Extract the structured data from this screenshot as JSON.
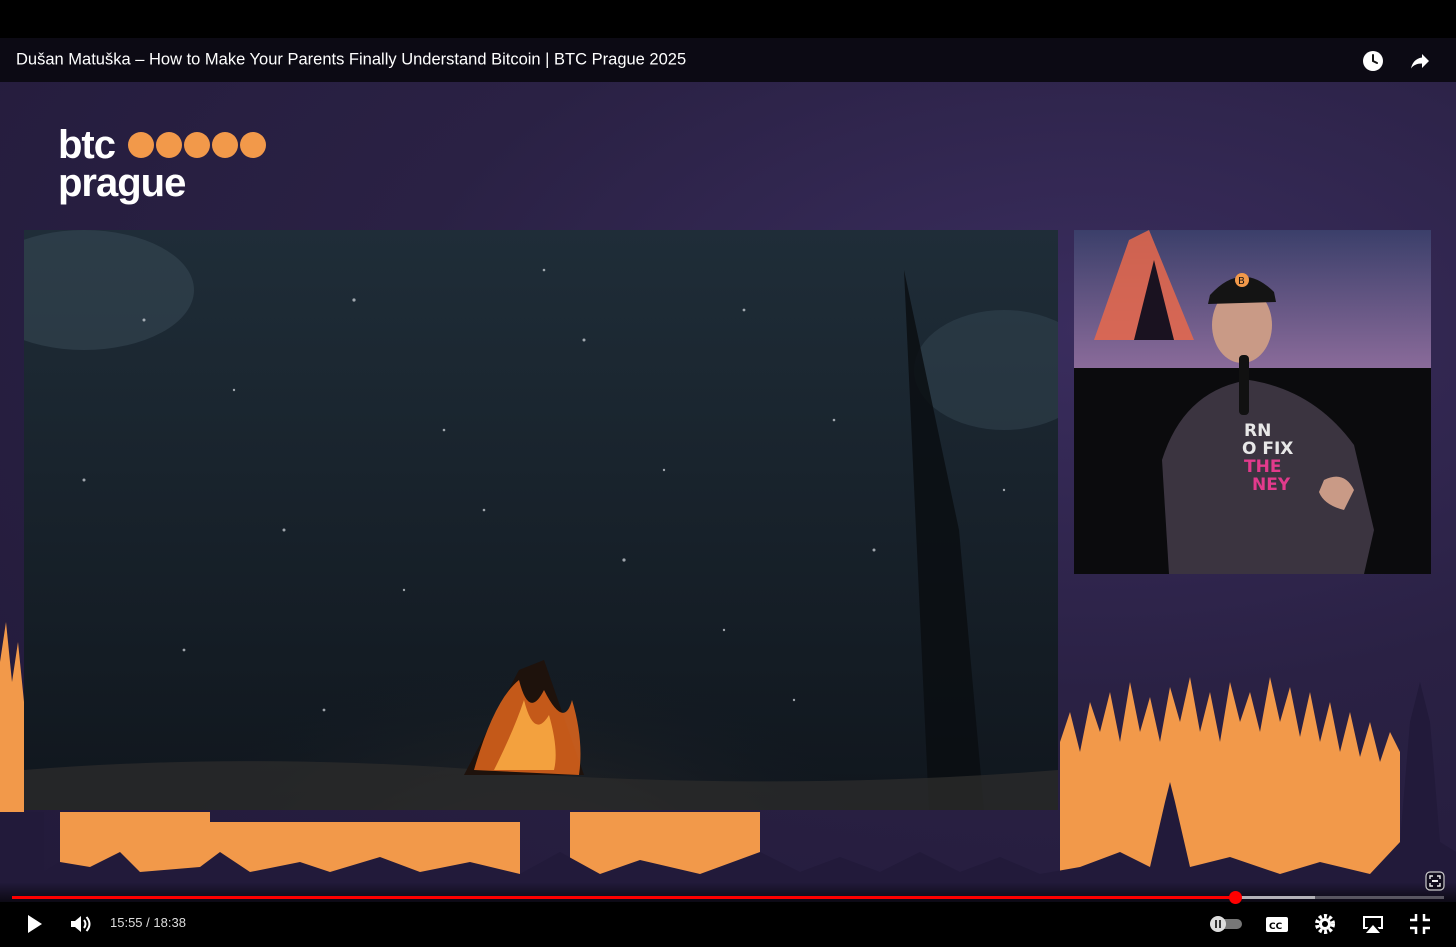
{
  "video": {
    "title": "Dušan Matuška – How to Make Your Parents Finally Understand Bitcoin | BTC Prague 2025"
  },
  "header_icons": {
    "watch_later": "clock-icon",
    "share": "share-arrow-icon"
  },
  "logo": {
    "line1": "btc",
    "line2": "prague",
    "dot_count": 5,
    "color": "#f2994a"
  },
  "speaker_shirt": {
    "line1": "RN",
    "line2": "O FIX",
    "line3": "THE",
    "line4": "NEY",
    "cap_symbol": "B"
  },
  "playback": {
    "current": "15:55",
    "separator": " / ",
    "duration": "18:38",
    "progress": 0.854,
    "buffered": 0.91
  },
  "colors": {
    "accent_orange": "#f2994a",
    "stage_purple": "#2a2144",
    "progress_red": "#ff0000"
  },
  "control_icons": [
    "play-icon",
    "volume-icon",
    "autoplay-toggle-icon",
    "captions-icon",
    "settings-gear-icon",
    "airplay-icon",
    "exit-fullscreen-icon"
  ]
}
